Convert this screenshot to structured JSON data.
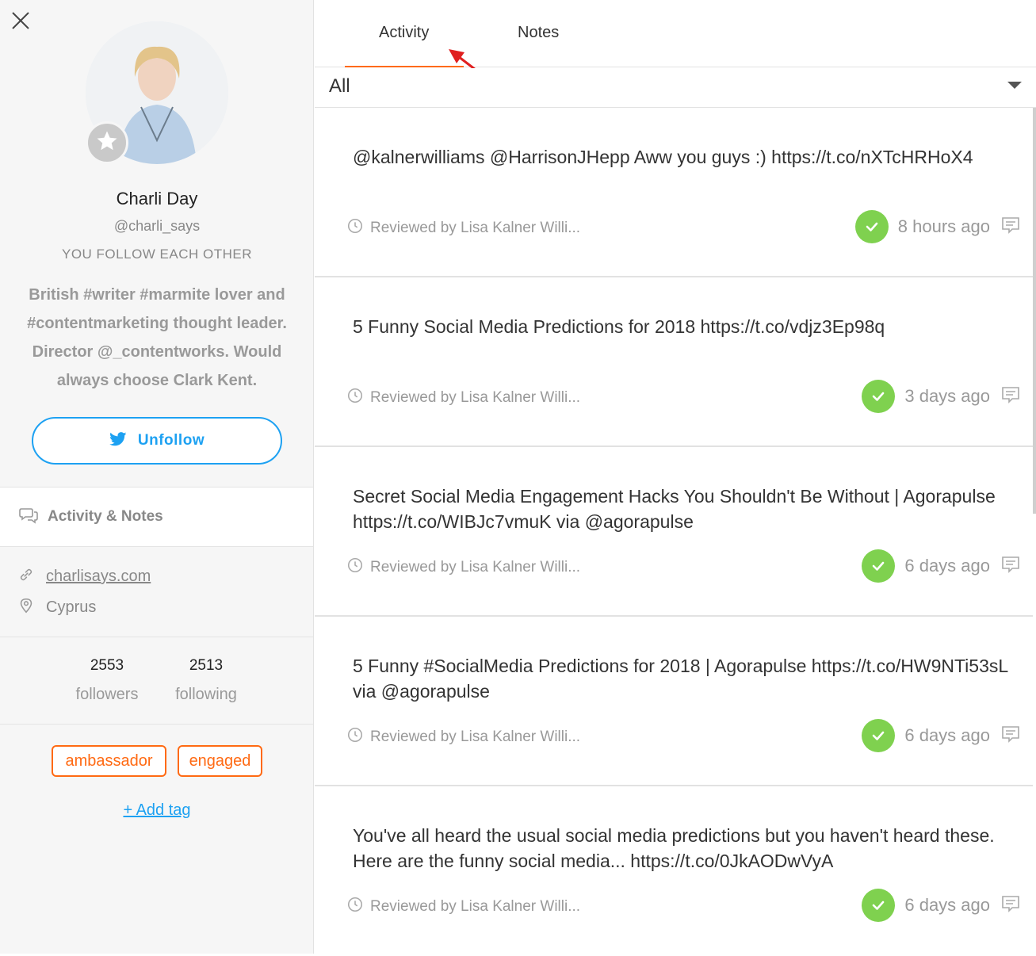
{
  "profile": {
    "name": "Charli Day",
    "handle": "@charli_says",
    "follow_status": "YOU FOLLOW EACH OTHER",
    "bio": "British #writer #marmite lover and #contentmarketing thought leader. Director @_contentworks. Would always choose Clark Kent.",
    "unfollow_label": "Unfollow",
    "activity_notes_label": "Activity & Notes",
    "website": "charlisays.com",
    "location": "Cyprus",
    "followers_count": "2553",
    "followers_label": "followers",
    "following_count": "2513",
    "following_label": "following",
    "tags": [
      "ambassador",
      "engaged"
    ],
    "add_tag_label": "+ Add tag"
  },
  "tabs": [
    {
      "label": "Activity",
      "active": true
    },
    {
      "label": "Notes",
      "active": false
    }
  ],
  "filter": {
    "value": "All"
  },
  "activity": [
    {
      "text": "@kalnerwilliams @HarrisonJHepp Aww you guys :) https://t.co/nXTcHRHoX4",
      "reviewed": "Reviewed by Lisa Kalner Willi...",
      "time": "8 hours ago"
    },
    {
      "text": "5 Funny Social Media Predictions for 2018 https://t.co/vdjz3Ep98q",
      "reviewed": "Reviewed by Lisa Kalner Willi...",
      "time": "3 days ago"
    },
    {
      "text": "Secret Social Media Engagement Hacks You Shouldn't Be Without | Agorapulse https://t.co/WIBJc7vmuK via @agorapulse",
      "reviewed": "Reviewed by Lisa Kalner Willi...",
      "time": "6 days ago"
    },
    {
      "text": "5 Funny #SocialMedia Predictions for 2018 | Agorapulse https://t.co/HW9NTi53sL via @agorapulse",
      "reviewed": "Reviewed by Lisa Kalner Willi...",
      "time": "6 days ago"
    },
    {
      "text": "You've all heard the usual social media predictions but you haven't heard these. Here are the funny social media... https://t.co/0JkAODwVyA",
      "reviewed": "Reviewed by Lisa Kalner Willi...",
      "time": "6 days ago"
    }
  ],
  "colors": {
    "accent_orange": "#ff6a13",
    "twitter_blue": "#1da1f2",
    "check_green": "#7fd14f",
    "annotation_arrow": "#e02020"
  },
  "icons": [
    "close-icon",
    "star-icon",
    "twitter-icon",
    "comments-icon",
    "link-icon",
    "location-pin-icon",
    "clock-icon",
    "checkmark-icon",
    "note-icon",
    "chevron-down-icon"
  ]
}
